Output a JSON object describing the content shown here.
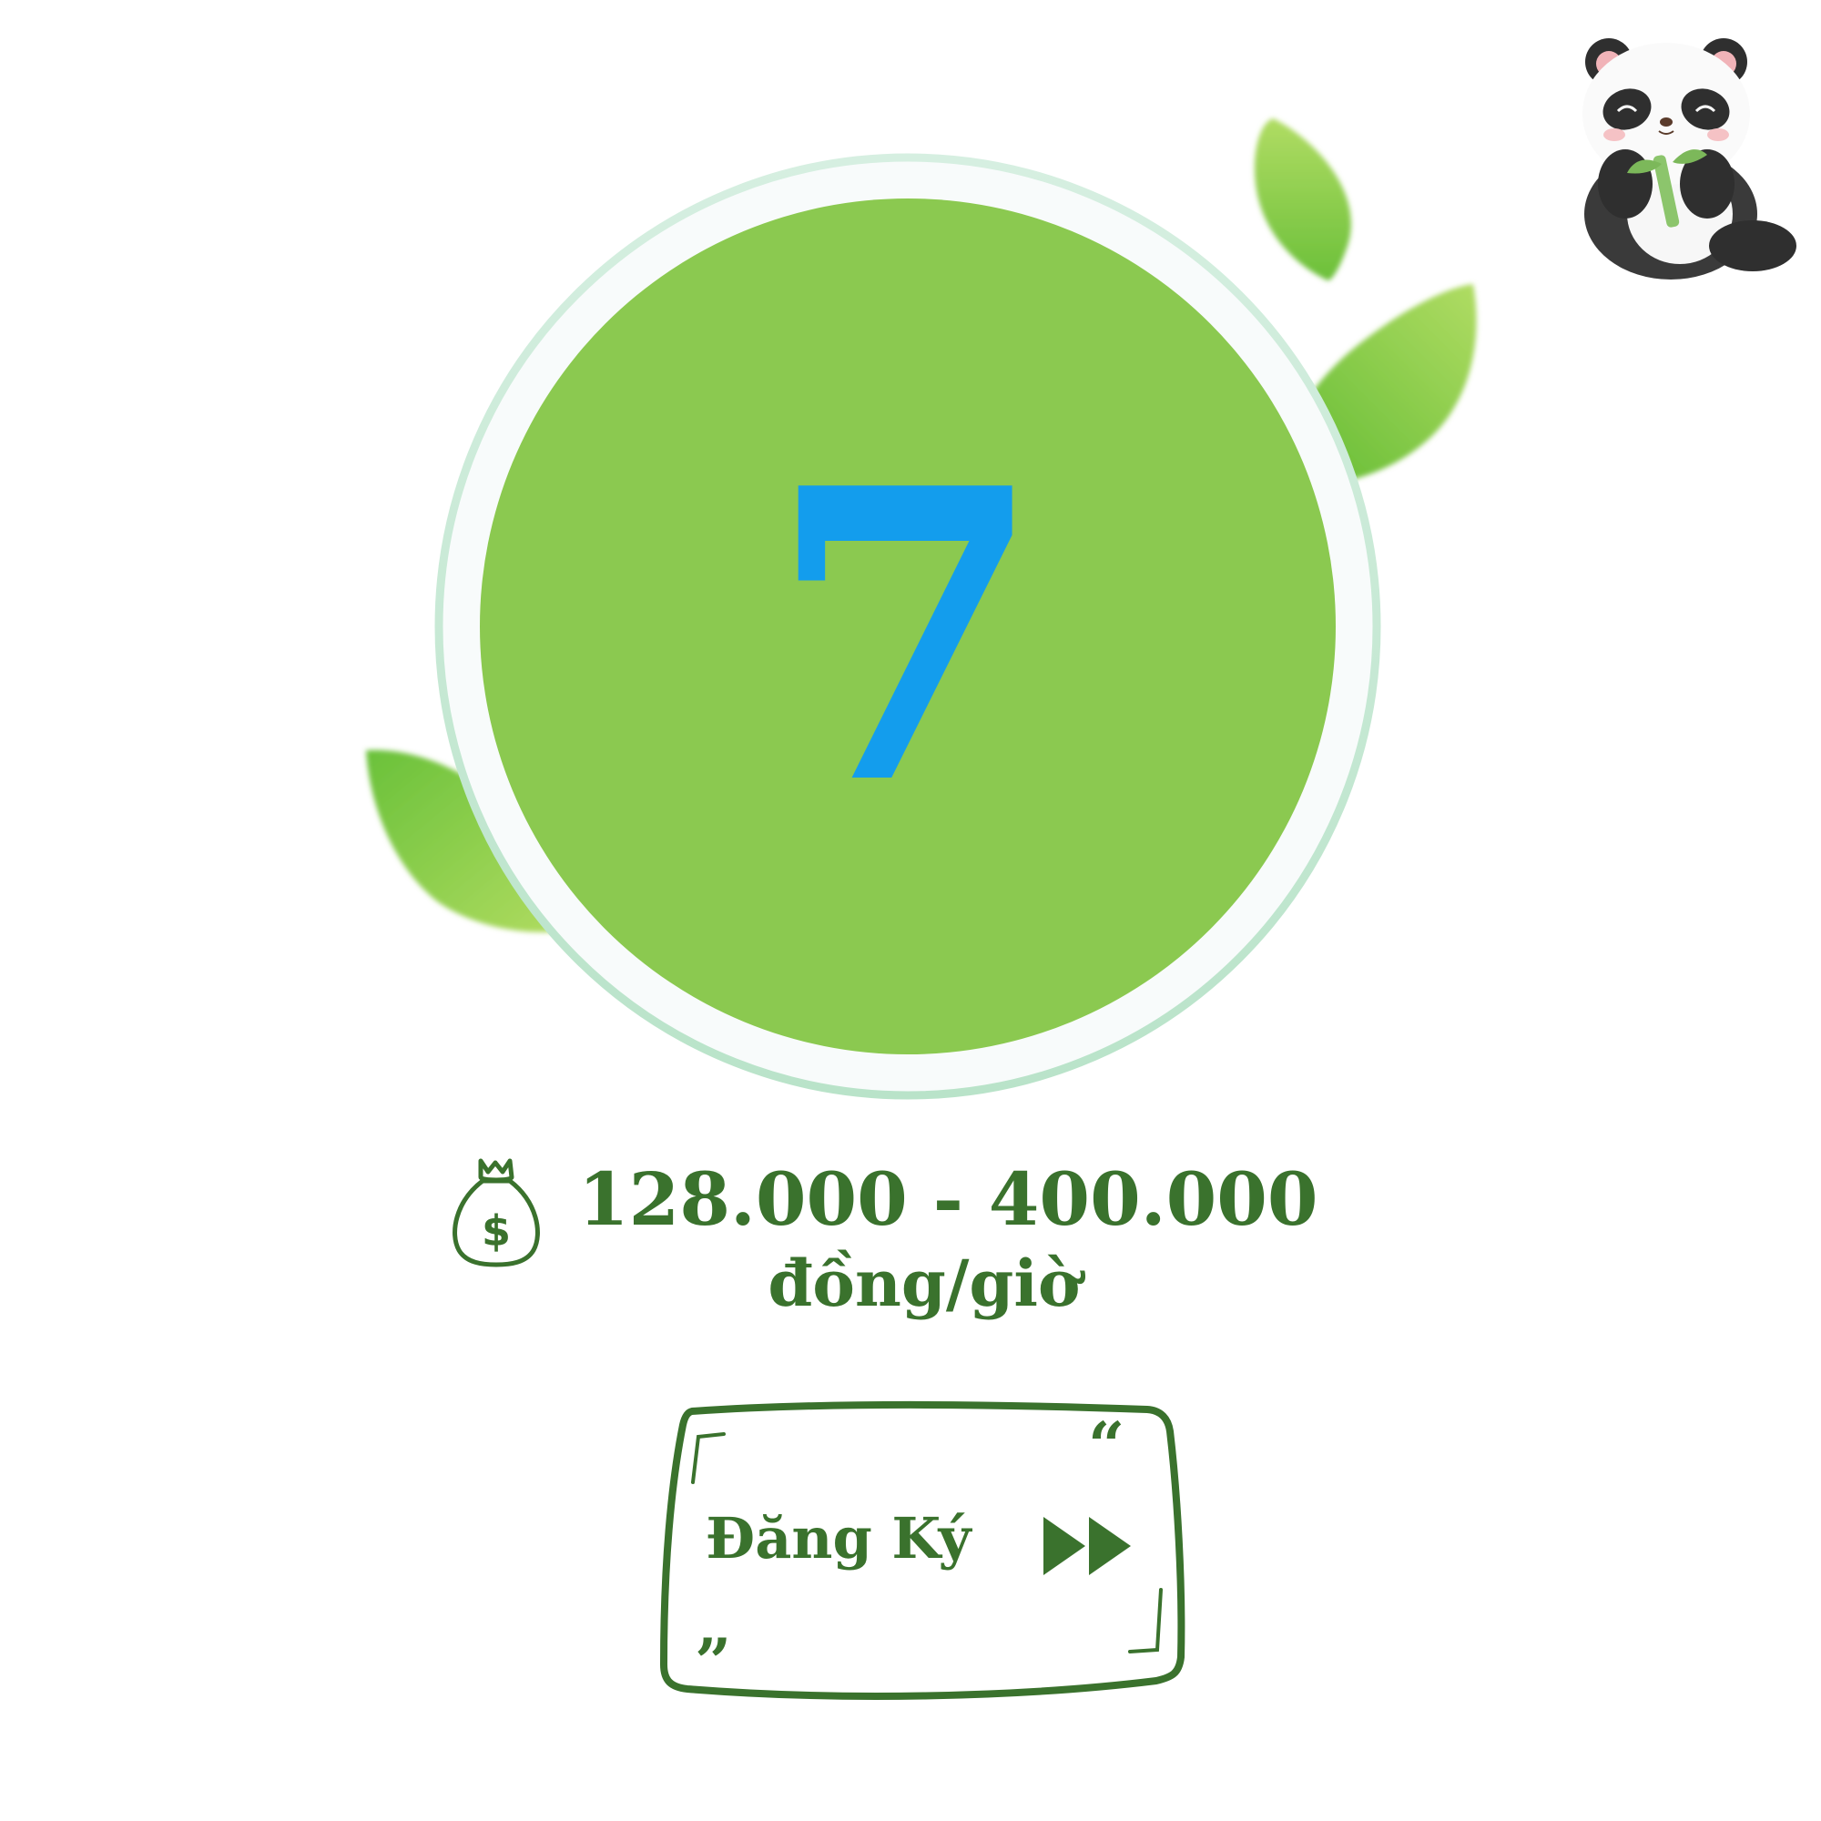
{
  "hero": {
    "number": "7"
  },
  "price": {
    "range": "128.000 - 400.000",
    "unit": "đồng/giờ",
    "icon": "money-bag-icon"
  },
  "register": {
    "label": "Đăng Ký",
    "icon": "fast-forward-icon"
  },
  "decorations": {
    "mascot": "panda-icon",
    "leaves": "leaf-icon"
  },
  "colors": {
    "circle": "#8bc950",
    "ring": "#c9ead8",
    "number": "#139ded",
    "text": "#3a722d",
    "leaf_dark": "#66bd36",
    "leaf_light": "#a8d95c"
  }
}
